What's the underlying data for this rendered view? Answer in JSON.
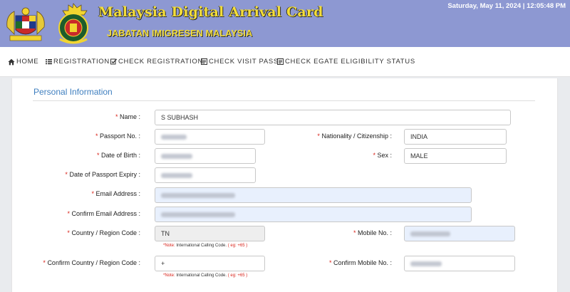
{
  "header": {
    "title": "Malaysia Digital Arrival Card",
    "subtitle": "JABATAN IMIGRESEN MALAYSIA",
    "datetime": "Saturday, May 11, 2024 | 12:05:48 PM",
    "banner_color": "#8d98d2",
    "title_color": "#f3dd3a"
  },
  "nav": {
    "items": [
      {
        "label": "HOME",
        "icon": "home-icon"
      },
      {
        "label": "REGISTRATION",
        "icon": "list-icon"
      },
      {
        "label": "CHECK REGISTRATION",
        "icon": "check-icon"
      },
      {
        "label": "CHECK VISIT PASS",
        "icon": "document-icon"
      },
      {
        "label": "CHECK EGATE ELIGIBILITY STATUS",
        "icon": "document-icon"
      }
    ]
  },
  "form": {
    "section_title": "Personal Information",
    "required_mark": "*",
    "fields": {
      "name": {
        "label": "Name :",
        "value": "S SUBHASH"
      },
      "passport": {
        "label": "Passport No. :",
        "value": ""
      },
      "nationality": {
        "label": "Nationality / Citizenship :",
        "value": "INDIA"
      },
      "dob": {
        "label": "Date of Birth :",
        "value": ""
      },
      "sex": {
        "label": "Sex :",
        "value": "MALE"
      },
      "passport_expiry": {
        "label": "Date of Passport Expiry :",
        "value": ""
      },
      "email": {
        "label": "Email Address :",
        "value": ""
      },
      "confirm_email": {
        "label": "Confirm Email Address :",
        "value": ""
      },
      "country_code": {
        "label": "Country / Region Code :",
        "value": "TN"
      },
      "mobile": {
        "label": "Mobile No. :",
        "value": ""
      },
      "confirm_country_code": {
        "label": "Confirm Country / Region Code :",
        "value": "+"
      },
      "confirm_mobile": {
        "label": "Confirm Mobile No. :",
        "value": ""
      }
    },
    "note": {
      "prefix": "*Note:",
      "text": " International Calling Code. ",
      "example": "( eg: +65 )"
    }
  },
  "colors": {
    "required": "#d9231a",
    "section_title": "#3f7fbf",
    "autofill_bg": "#e8f0fd"
  }
}
